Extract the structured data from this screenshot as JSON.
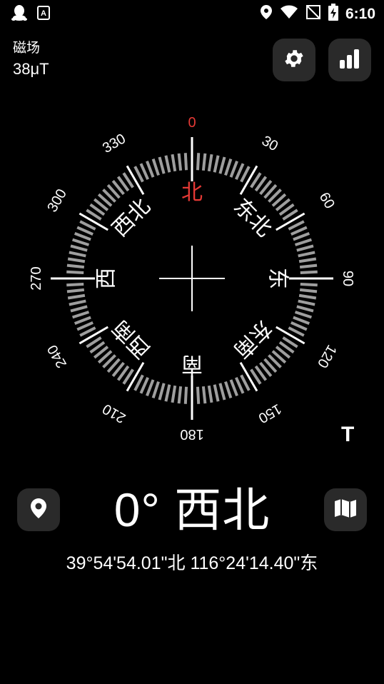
{
  "status_bar": {
    "time": "6:10",
    "icons": [
      "qq-icon",
      "a-badge-icon",
      "location-icon",
      "wifi-icon",
      "signal-off-icon",
      "battery-charging-icon"
    ]
  },
  "magnetic_field": {
    "label": "磁场",
    "value": "38μT"
  },
  "toolbar": {
    "settings": "gear-icon",
    "stats": "bar-chart-icon"
  },
  "compass": {
    "degree_labels": [
      "0",
      "30",
      "60",
      "90",
      "120",
      "150",
      "180",
      "210",
      "240",
      "270",
      "300",
      "330"
    ],
    "direction_labels": [
      "北",
      "东北",
      "东",
      "东南",
      "南",
      "西南",
      "西",
      "西北"
    ],
    "north_color": "#e53935",
    "tick_color": "#9e9e9e",
    "heading_deg": 0
  },
  "heading": {
    "text": "0° 西北"
  },
  "coordinates": {
    "text": "39°54'54.01\"北  116°24'14.40\"东"
  },
  "true_north_label": "T",
  "bottom_buttons": {
    "location": "location-pin-icon",
    "map": "map-icon"
  }
}
